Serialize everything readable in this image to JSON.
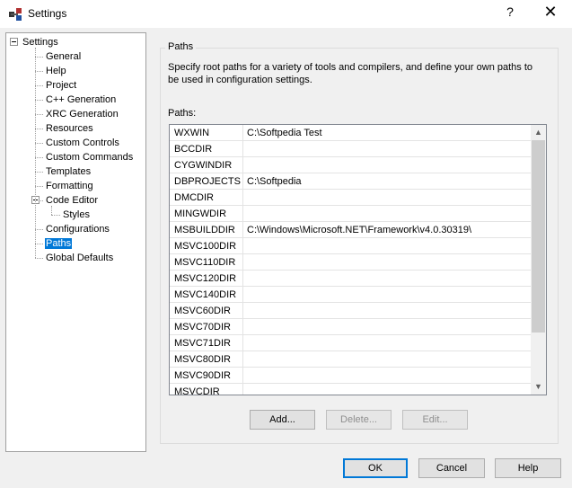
{
  "window": {
    "title": "Settings",
    "help_glyph": "?",
    "close_glyph": "✕",
    "icon": "settings-app-icon"
  },
  "tree": {
    "root": "Settings",
    "items": [
      "General",
      "Help",
      "Project",
      "C++ Generation",
      "XRC Generation",
      "Resources",
      "Custom Controls",
      "Custom Commands",
      "Templates",
      "Formatting",
      "Code Editor",
      "Styles",
      "Configurations",
      "Paths",
      "Global Defaults"
    ],
    "selected": "Paths"
  },
  "paths_group": {
    "title": "Paths",
    "description": "Specify root paths for a variety of tools and compilers, and define your own paths to be used in configuration settings.",
    "list_label": "Paths:",
    "rows": [
      {
        "name": "WXWIN",
        "value": "C:\\Softpedia Test"
      },
      {
        "name": "BCCDIR",
        "value": ""
      },
      {
        "name": "CYGWINDIR",
        "value": ""
      },
      {
        "name": "DBPROJECTS",
        "value": "C:\\Softpedia"
      },
      {
        "name": "DMCDIR",
        "value": ""
      },
      {
        "name": "MINGWDIR",
        "value": ""
      },
      {
        "name": "MSBUILDDIR",
        "value": "C:\\Windows\\Microsoft.NET\\Framework\\v4.0.30319\\"
      },
      {
        "name": "MSVC100DIR",
        "value": ""
      },
      {
        "name": "MSVC110DIR",
        "value": ""
      },
      {
        "name": "MSVC120DIR",
        "value": ""
      },
      {
        "name": "MSVC140DIR",
        "value": ""
      },
      {
        "name": "MSVC60DIR",
        "value": ""
      },
      {
        "name": "MSVC70DIR",
        "value": ""
      },
      {
        "name": "MSVC71DIR",
        "value": ""
      },
      {
        "name": "MSVC80DIR",
        "value": ""
      },
      {
        "name": "MSVC90DIR",
        "value": ""
      },
      {
        "name": "MSVCDIR",
        "value": ""
      }
    ],
    "add_label": "Add...",
    "delete_label": "Delete...",
    "edit_label": "Edit..."
  },
  "dialog_buttons": {
    "ok": "OK",
    "cancel": "Cancel",
    "help": "Help"
  },
  "colors": {
    "selection": "#0078d7",
    "background": "#f0f0f0"
  }
}
